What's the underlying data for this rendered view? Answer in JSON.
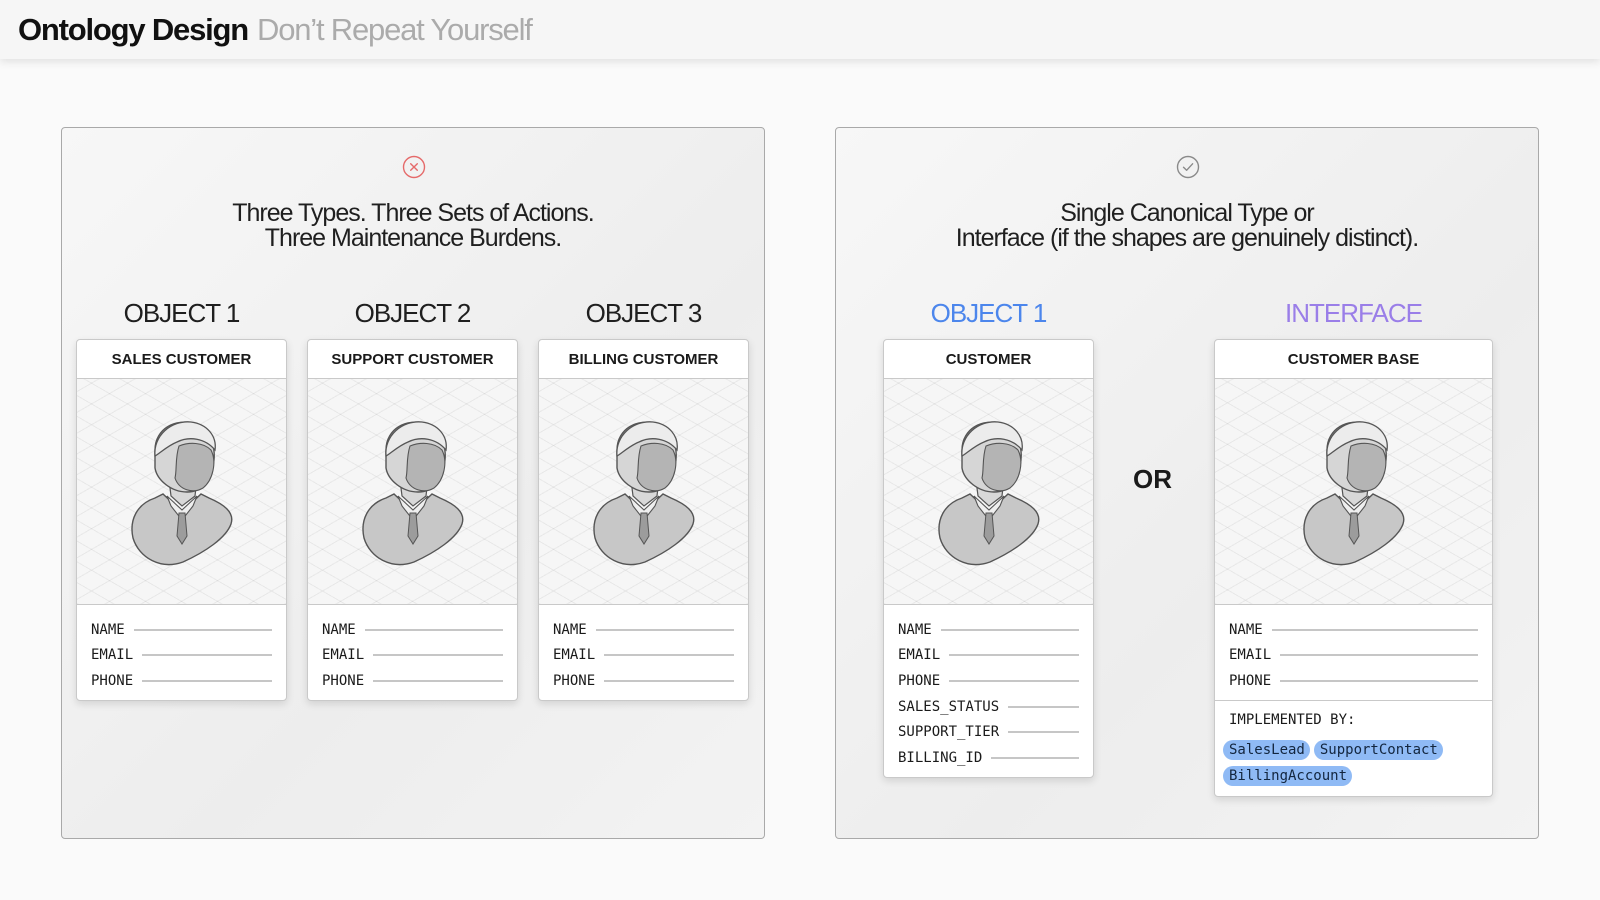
{
  "header": {
    "title": "Ontology Design",
    "subtitle": "Don’t Repeat Yourself"
  },
  "left_panel": {
    "status_icon": "x-circle-icon",
    "heading_line1": "Three Types. Three Sets of Actions.",
    "heading_line2": "Three Maintenance Burdens.",
    "columns": [
      {
        "label": "OBJECT 1",
        "card_title": "SALES CUSTOMER",
        "icon": "person-icon",
        "fields": [
          "NAME",
          "EMAIL",
          "PHONE"
        ]
      },
      {
        "label": "OBJECT 2",
        "card_title": "SUPPORT CUSTOMER",
        "icon": "person-icon",
        "fields": [
          "NAME",
          "EMAIL",
          "PHONE"
        ]
      },
      {
        "label": "OBJECT 3",
        "card_title": "BILLING CUSTOMER",
        "icon": "person-icon",
        "fields": [
          "NAME",
          "EMAIL",
          "PHONE"
        ]
      }
    ]
  },
  "right_panel": {
    "status_icon": "check-circle-icon",
    "heading_line1": "Single Canonical Type or",
    "heading_line2": "Interface (if the shapes are genuinely distinct).",
    "or_label": "OR",
    "object": {
      "label": "OBJECT 1",
      "card_title": "CUSTOMER",
      "icon": "person-icon",
      "fields": [
        "NAME",
        "EMAIL",
        "PHONE",
        "SALES_STATUS",
        "SUPPORT_TIER",
        "BILLING_ID"
      ]
    },
    "interface": {
      "label": "INTERFACE",
      "card_title": "CUSTOMER BASE",
      "icon": "person-icon",
      "fields": [
        "NAME",
        "EMAIL",
        "PHONE"
      ],
      "implemented_by_title": "IMPLEMENTED BY:",
      "implemented_by": [
        "SalesLead",
        "SupportContact",
        "BillingAccount"
      ]
    }
  },
  "colors": {
    "accent_blue": "#4c86ec",
    "accent_purple": "#9a7ee8",
    "error_red": "#e56a6a",
    "ok_gray": "#8a8a8a",
    "tag_bg": "#8fbaf5"
  }
}
